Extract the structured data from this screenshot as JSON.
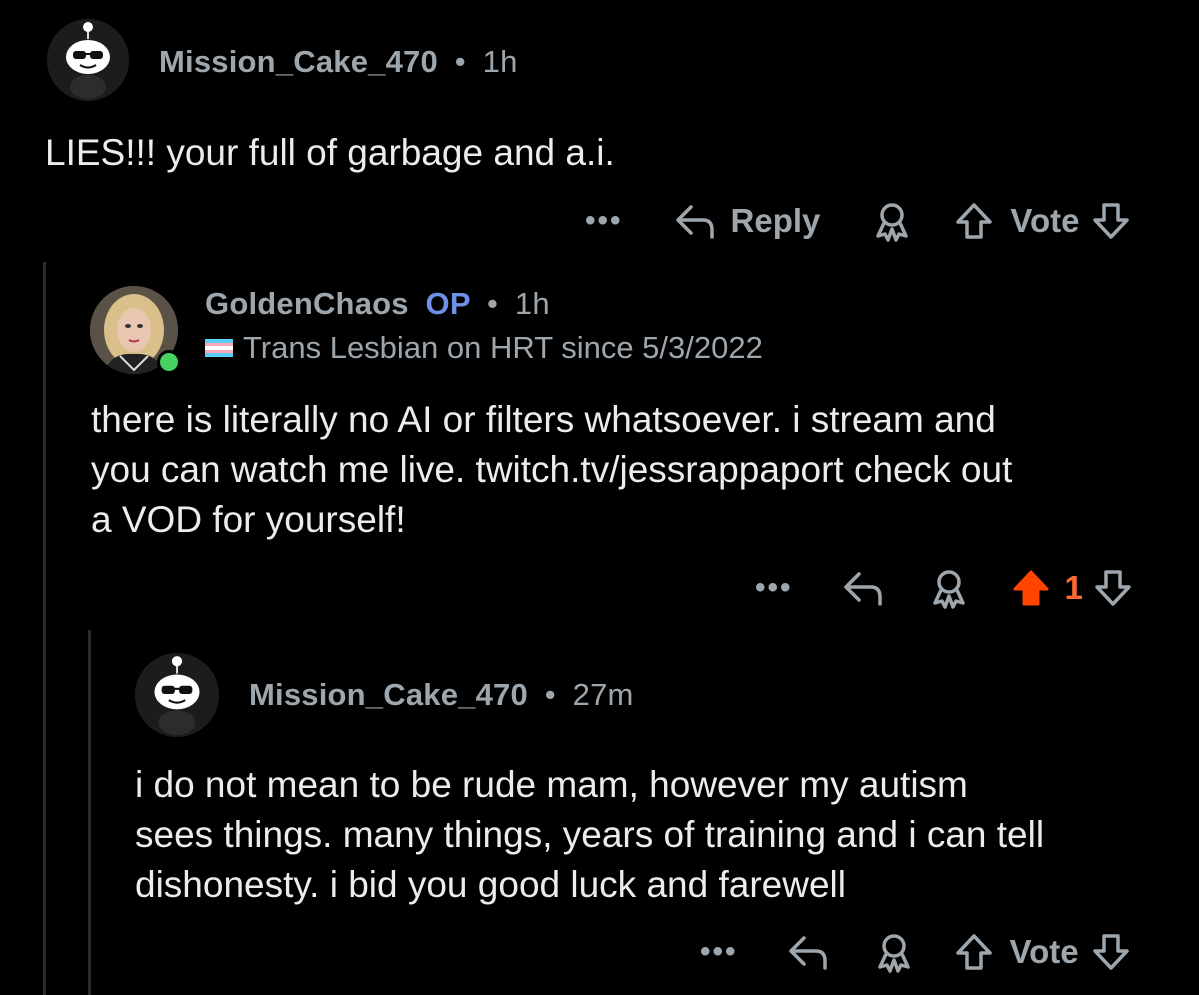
{
  "comments": [
    {
      "username": "Mission_Cake_470",
      "time": "1h",
      "body": [
        "LIES!!! your full of garbage and a.i."
      ],
      "actions": {
        "more": "•••",
        "reply": "Reply",
        "vote": "Vote"
      }
    },
    {
      "username": "GoldenChaos",
      "op_badge": "OP",
      "time": "1h",
      "flair": "Trans Lesbian on HRT since 5/3/2022",
      "online": true,
      "body": [
        "there is literally no AI or filters whatsoever. i stream and",
        "you can watch me live. twitch.tv/jessrappaport check out",
        "a VOD for yourself!"
      ],
      "actions": {
        "more": "•••",
        "score": "1",
        "upvoted": true
      }
    },
    {
      "username": "Mission_Cake_470",
      "time": "27m",
      "body": [
        "i do not mean to be rude mam, however my autism",
        "sees things. many things, years of training and i can tell",
        "dishonesty. i bid you good luck and farewell"
      ],
      "actions": {
        "more": "•••",
        "vote": "Vote"
      }
    }
  ],
  "separator": "•",
  "colors": {
    "background": "#000000",
    "meta": "#9ea6ad",
    "op": "#6f8fe8",
    "upvote": "#ff4500",
    "online": "#46d160"
  },
  "icons": [
    "snoo-avatar",
    "reply-arrow-icon",
    "award-icon",
    "upvote-icon",
    "downvote-icon",
    "more-dots-icon",
    "trans-flag-icon"
  ]
}
